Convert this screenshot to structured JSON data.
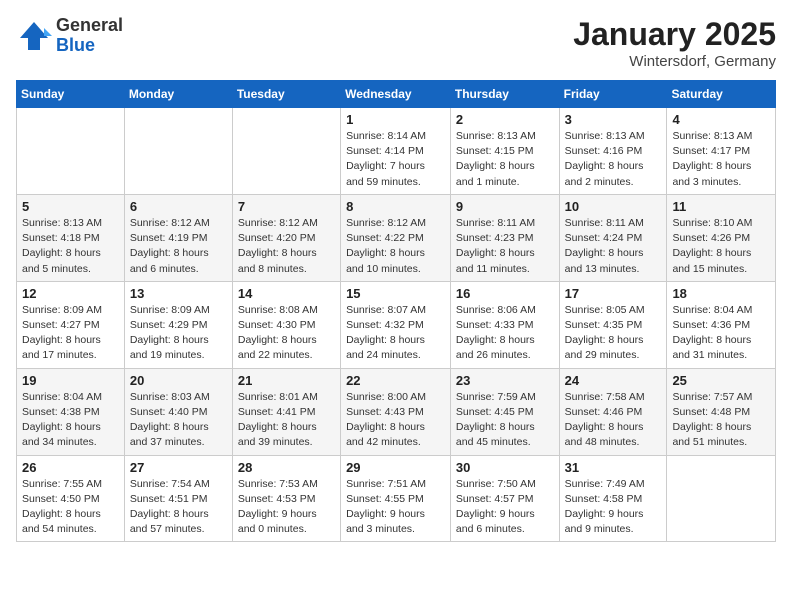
{
  "logo": {
    "general": "General",
    "blue": "Blue"
  },
  "header": {
    "month": "January 2025",
    "location": "Wintersdorf, Germany"
  },
  "days_of_week": [
    "Sunday",
    "Monday",
    "Tuesday",
    "Wednesday",
    "Thursday",
    "Friday",
    "Saturday"
  ],
  "weeks": [
    [
      {
        "day": "",
        "info": ""
      },
      {
        "day": "",
        "info": ""
      },
      {
        "day": "",
        "info": ""
      },
      {
        "day": "1",
        "info": "Sunrise: 8:14 AM\nSunset: 4:14 PM\nDaylight: 7 hours\nand 59 minutes."
      },
      {
        "day": "2",
        "info": "Sunrise: 8:13 AM\nSunset: 4:15 PM\nDaylight: 8 hours\nand 1 minute."
      },
      {
        "day": "3",
        "info": "Sunrise: 8:13 AM\nSunset: 4:16 PM\nDaylight: 8 hours\nand 2 minutes."
      },
      {
        "day": "4",
        "info": "Sunrise: 8:13 AM\nSunset: 4:17 PM\nDaylight: 8 hours\nand 3 minutes."
      }
    ],
    [
      {
        "day": "5",
        "info": "Sunrise: 8:13 AM\nSunset: 4:18 PM\nDaylight: 8 hours\nand 5 minutes."
      },
      {
        "day": "6",
        "info": "Sunrise: 8:12 AM\nSunset: 4:19 PM\nDaylight: 8 hours\nand 6 minutes."
      },
      {
        "day": "7",
        "info": "Sunrise: 8:12 AM\nSunset: 4:20 PM\nDaylight: 8 hours\nand 8 minutes."
      },
      {
        "day": "8",
        "info": "Sunrise: 8:12 AM\nSunset: 4:22 PM\nDaylight: 8 hours\nand 10 minutes."
      },
      {
        "day": "9",
        "info": "Sunrise: 8:11 AM\nSunset: 4:23 PM\nDaylight: 8 hours\nand 11 minutes."
      },
      {
        "day": "10",
        "info": "Sunrise: 8:11 AM\nSunset: 4:24 PM\nDaylight: 8 hours\nand 13 minutes."
      },
      {
        "day": "11",
        "info": "Sunrise: 8:10 AM\nSunset: 4:26 PM\nDaylight: 8 hours\nand 15 minutes."
      }
    ],
    [
      {
        "day": "12",
        "info": "Sunrise: 8:09 AM\nSunset: 4:27 PM\nDaylight: 8 hours\nand 17 minutes."
      },
      {
        "day": "13",
        "info": "Sunrise: 8:09 AM\nSunset: 4:29 PM\nDaylight: 8 hours\nand 19 minutes."
      },
      {
        "day": "14",
        "info": "Sunrise: 8:08 AM\nSunset: 4:30 PM\nDaylight: 8 hours\nand 22 minutes."
      },
      {
        "day": "15",
        "info": "Sunrise: 8:07 AM\nSunset: 4:32 PM\nDaylight: 8 hours\nand 24 minutes."
      },
      {
        "day": "16",
        "info": "Sunrise: 8:06 AM\nSunset: 4:33 PM\nDaylight: 8 hours\nand 26 minutes."
      },
      {
        "day": "17",
        "info": "Sunrise: 8:05 AM\nSunset: 4:35 PM\nDaylight: 8 hours\nand 29 minutes."
      },
      {
        "day": "18",
        "info": "Sunrise: 8:04 AM\nSunset: 4:36 PM\nDaylight: 8 hours\nand 31 minutes."
      }
    ],
    [
      {
        "day": "19",
        "info": "Sunrise: 8:04 AM\nSunset: 4:38 PM\nDaylight: 8 hours\nand 34 minutes."
      },
      {
        "day": "20",
        "info": "Sunrise: 8:03 AM\nSunset: 4:40 PM\nDaylight: 8 hours\nand 37 minutes."
      },
      {
        "day": "21",
        "info": "Sunrise: 8:01 AM\nSunset: 4:41 PM\nDaylight: 8 hours\nand 39 minutes."
      },
      {
        "day": "22",
        "info": "Sunrise: 8:00 AM\nSunset: 4:43 PM\nDaylight: 8 hours\nand 42 minutes."
      },
      {
        "day": "23",
        "info": "Sunrise: 7:59 AM\nSunset: 4:45 PM\nDaylight: 8 hours\nand 45 minutes."
      },
      {
        "day": "24",
        "info": "Sunrise: 7:58 AM\nSunset: 4:46 PM\nDaylight: 8 hours\nand 48 minutes."
      },
      {
        "day": "25",
        "info": "Sunrise: 7:57 AM\nSunset: 4:48 PM\nDaylight: 8 hours\nand 51 minutes."
      }
    ],
    [
      {
        "day": "26",
        "info": "Sunrise: 7:55 AM\nSunset: 4:50 PM\nDaylight: 8 hours\nand 54 minutes."
      },
      {
        "day": "27",
        "info": "Sunrise: 7:54 AM\nSunset: 4:51 PM\nDaylight: 8 hours\nand 57 minutes."
      },
      {
        "day": "28",
        "info": "Sunrise: 7:53 AM\nSunset: 4:53 PM\nDaylight: 9 hours\nand 0 minutes."
      },
      {
        "day": "29",
        "info": "Sunrise: 7:51 AM\nSunset: 4:55 PM\nDaylight: 9 hours\nand 3 minutes."
      },
      {
        "day": "30",
        "info": "Sunrise: 7:50 AM\nSunset: 4:57 PM\nDaylight: 9 hours\nand 6 minutes."
      },
      {
        "day": "31",
        "info": "Sunrise: 7:49 AM\nSunset: 4:58 PM\nDaylight: 9 hours\nand 9 minutes."
      },
      {
        "day": "",
        "info": ""
      }
    ]
  ]
}
